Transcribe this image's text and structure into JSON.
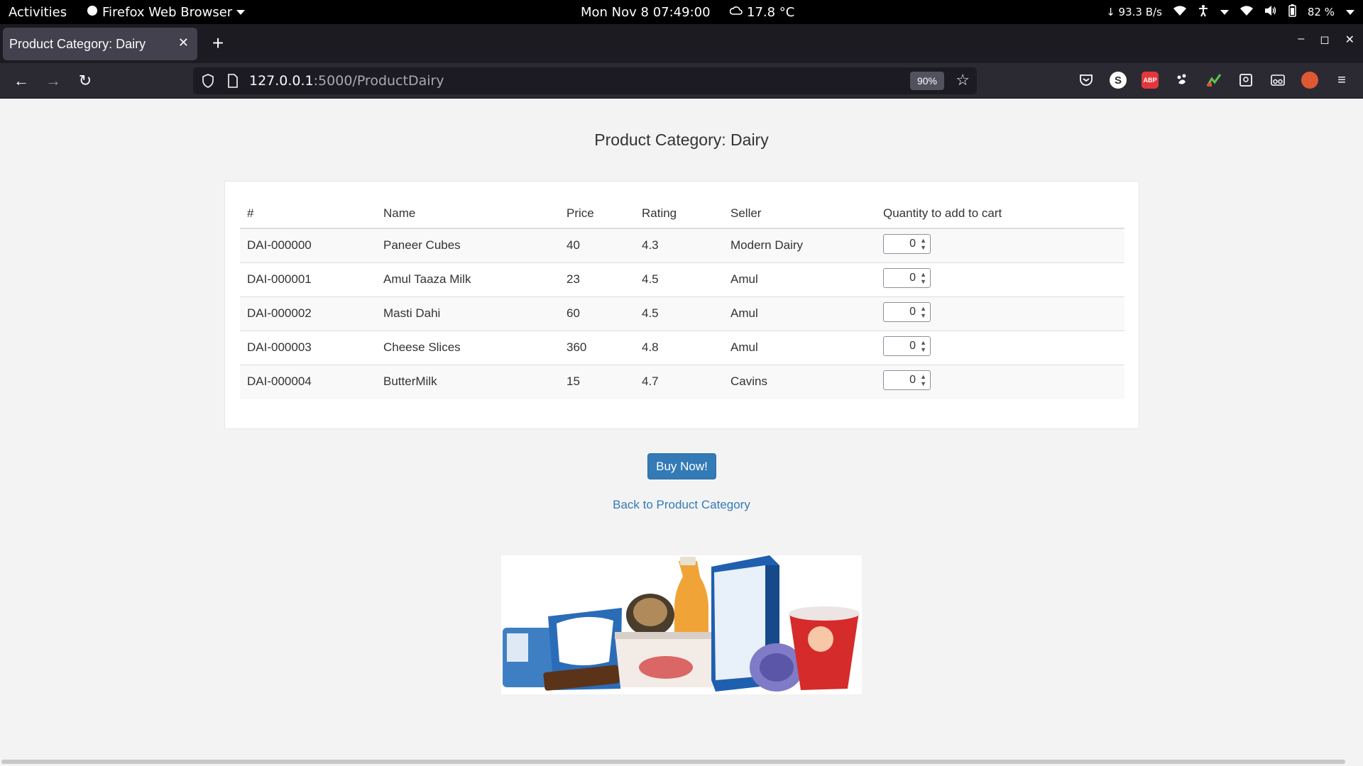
{
  "system_bar": {
    "activities": "Activities",
    "app_name": "Firefox Web Browser",
    "clock": "Mon Nov 8  07:49:00",
    "weather": "17.8 °C",
    "net_speed": "↓ 93.3 B/s",
    "battery": "82 %"
  },
  "browser": {
    "tab_title": "Product Category: Dairy",
    "url_host": "127.0.0.1",
    "url_path": ":5000/ProductDairy",
    "zoom": "90%"
  },
  "page": {
    "title": "Product Category: Dairy",
    "columns": [
      "#",
      "Name",
      "Price",
      "Rating",
      "Seller",
      "Quantity to add to cart"
    ],
    "rows": [
      {
        "id": "DAI-000000",
        "name": "Paneer Cubes",
        "price": "40",
        "rating": "4.3",
        "seller": "Modern Dairy",
        "qty": "0"
      },
      {
        "id": "DAI-000001",
        "name": "Amul Taaza Milk",
        "price": "23",
        "rating": "4.5",
        "seller": "Amul",
        "qty": "0"
      },
      {
        "id": "DAI-000002",
        "name": "Masti Dahi",
        "price": "60",
        "rating": "4.5",
        "seller": "Amul",
        "qty": "0"
      },
      {
        "id": "DAI-000003",
        "name": "Cheese Slices",
        "price": "360",
        "rating": "4.8",
        "seller": "Amul",
        "qty": "0"
      },
      {
        "id": "DAI-000004",
        "name": "ButterMilk",
        "price": "15",
        "rating": "4.7",
        "seller": "Cavins",
        "qty": "0"
      }
    ],
    "buy_button": "Buy Now!",
    "back_link": "Back to Product Category"
  },
  "colors": {
    "link": "#337ab7",
    "button": "#337ab7",
    "browser_chrome": "#2b2a33"
  },
  "icons": [
    "firefox-icon",
    "weather-icon",
    "wifi-icon",
    "volume-icon",
    "battery-icon",
    "accessibility-icon",
    "back-icon",
    "forward-icon",
    "reload-icon",
    "shield-icon",
    "page-icon",
    "star-icon",
    "pocket-icon",
    "menu-icon"
  ]
}
